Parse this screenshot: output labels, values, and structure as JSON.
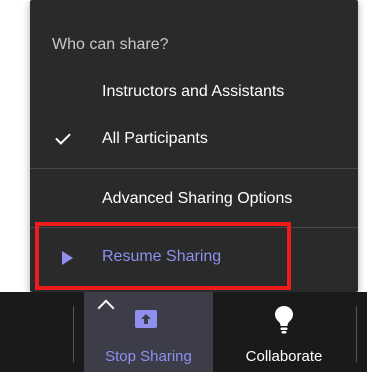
{
  "share_menu": {
    "heading": "Who can share?",
    "items": [
      {
        "label": "Instructors and Assistants",
        "checked": false
      },
      {
        "label": "All Participants",
        "checked": true
      }
    ],
    "advanced_label": "Advanced Sharing Options",
    "resume_label": "Resume Sharing"
  },
  "toolbar": {
    "stop_sharing_label": "Stop Sharing",
    "collaborate_label": "Collaborate"
  },
  "colors": {
    "accent": "#8f8ff0",
    "menu_bg": "#2a2a2a",
    "toolbar_bg": "#1a1a1a",
    "highlight": "#ee1c1c"
  },
  "icons": {
    "check": "checkmark-icon",
    "resume": "play-icon",
    "share": "share-screen-icon",
    "options": "chevron-up-icon",
    "collaborate": "lightbulb-icon"
  }
}
